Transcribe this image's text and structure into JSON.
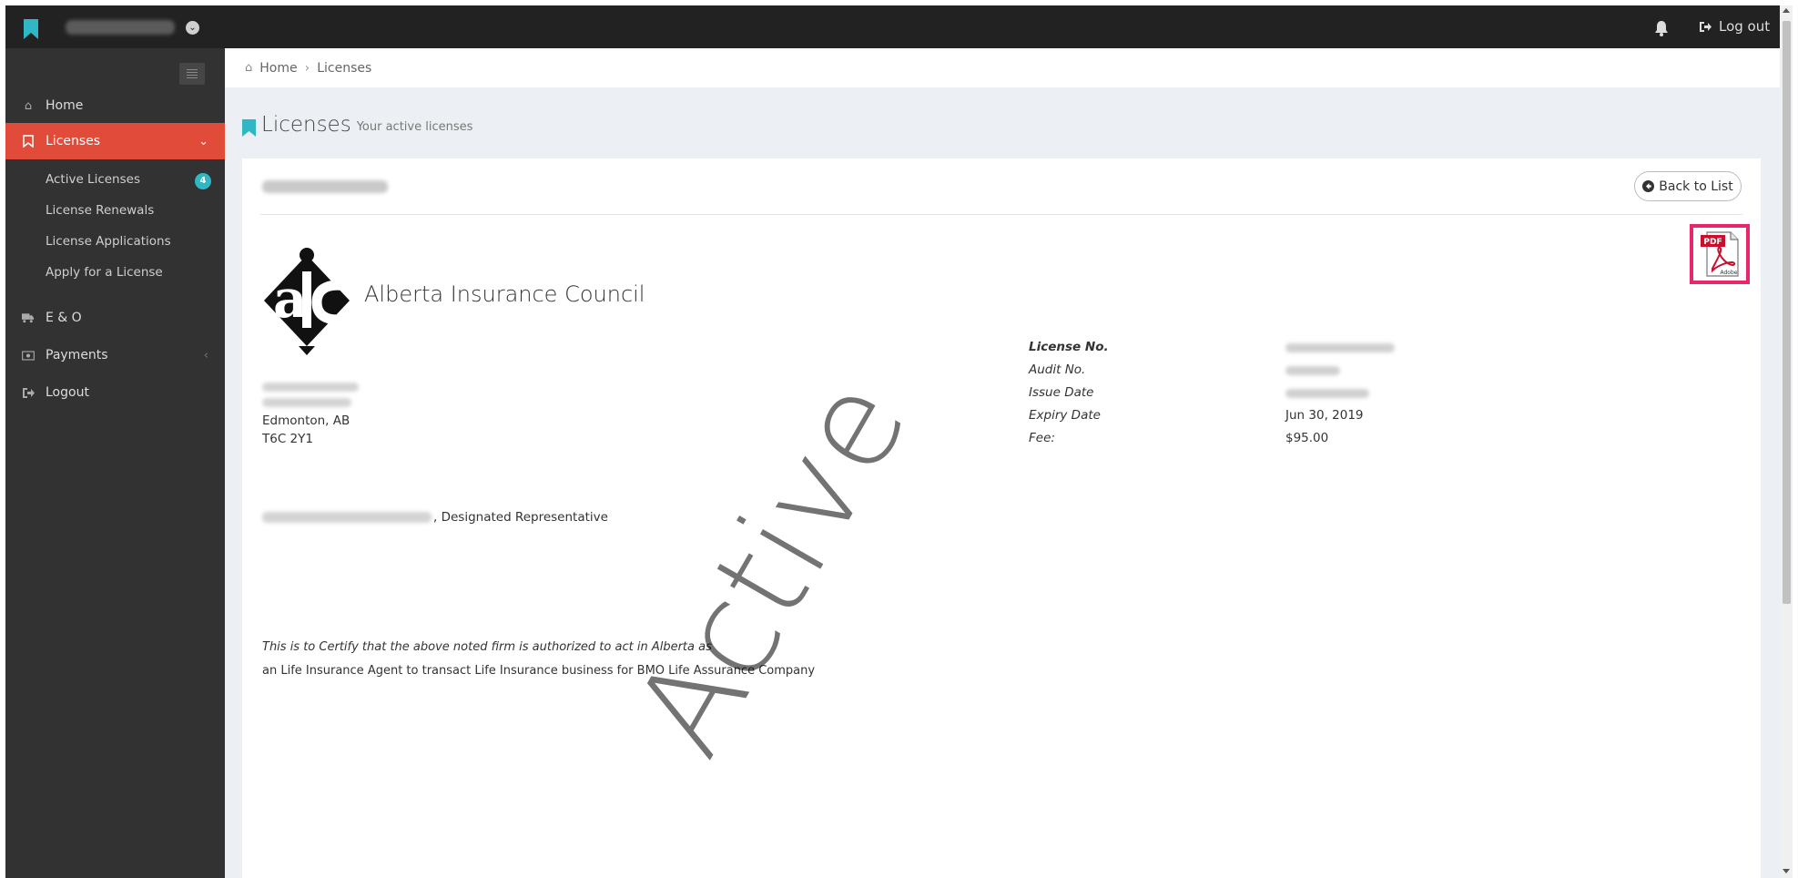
{
  "topbar": {
    "company_name": "",
    "logout_label": "Log out"
  },
  "sidebar": {
    "items": [
      {
        "label": "Home",
        "icon": "home-icon"
      },
      {
        "label": "Licenses",
        "icon": "bookmark-icon"
      },
      {
        "label": "E & O",
        "icon": "truck-icon"
      },
      {
        "label": "Payments",
        "icon": "money-icon"
      },
      {
        "label": "Logout",
        "icon": "sign-out-icon"
      }
    ],
    "license_sub": [
      {
        "label": "Active Licenses",
        "badge": "4"
      },
      {
        "label": "License Renewals"
      },
      {
        "label": "License Applications"
      },
      {
        "label": "Apply for a License"
      }
    ]
  },
  "breadcrumb": {
    "home": "Home",
    "separator": "›",
    "current": "Licenses"
  },
  "page": {
    "title": "Licenses",
    "subtitle": "Your active licenses"
  },
  "panel": {
    "back_label": "Back to List",
    "org_name": "Alberta Insurance Council",
    "address": {
      "city": "Edmonton, AB",
      "postal": "T6C 2Y1"
    },
    "representative_suffix": ", Designated Representative",
    "details": {
      "license_no_label": "License No.",
      "audit_no_label": "Audit No.",
      "issue_date_label": "Issue Date",
      "expiry_date_label": "Expiry Date",
      "expiry_date_value": "Jun 30, 2019",
      "fee_label": "Fee:",
      "fee_value": "$95.00"
    },
    "certify_line1": "This is to Certify that the above noted firm is authorized to act in Alberta as",
    "certify_line2": "an Life Insurance Agent to transact Life Insurance business for BMO Life Assurance Company",
    "watermark": "Active",
    "pdf_label": "PDF",
    "pdf_sub": "Adobe"
  },
  "colors": {
    "accent": "#2fb7c6",
    "active_nav": "#e04b3a",
    "pdf_highlight": "#e8266c"
  }
}
